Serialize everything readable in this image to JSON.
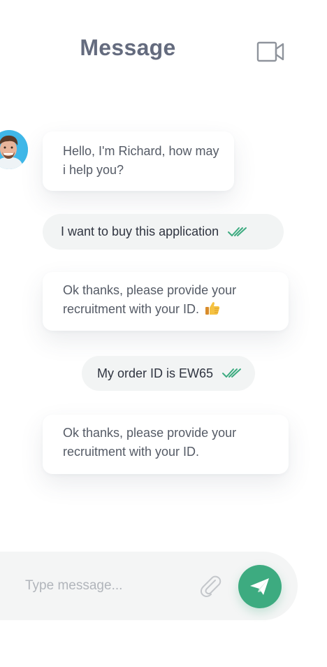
{
  "header": {
    "title": "Message",
    "video_call_icon": "video-camera-icon"
  },
  "conversation": {
    "agent_avatar": "avatar-icon",
    "messages": [
      {
        "direction": "incoming",
        "text": "Hello, I'm Richard, how may i help you?"
      },
      {
        "direction": "outgoing",
        "text": "I want to buy this application",
        "status_icon": "double-check-icon"
      },
      {
        "direction": "incoming",
        "text": "Ok thanks, please provide your recruitment with your ID.",
        "emoji_icon": "thumbs-up-icon"
      },
      {
        "direction": "outgoing",
        "text": "My order ID is EW65",
        "status_icon": "double-check-icon"
      },
      {
        "direction": "incoming",
        "text": "Ok thanks, please provide your recruitment with your ID."
      }
    ]
  },
  "composer": {
    "placeholder": "Type message...",
    "value": "",
    "attach_icon": "paperclip-icon",
    "send_icon": "paper-plane-icon"
  },
  "colors": {
    "title": "#646b7e",
    "accent_green": "#3dab80",
    "incoming_bubble": "#ffffff",
    "outgoing_bubble": "#f2f4f4",
    "composer_bg": "#f4f5f5"
  }
}
